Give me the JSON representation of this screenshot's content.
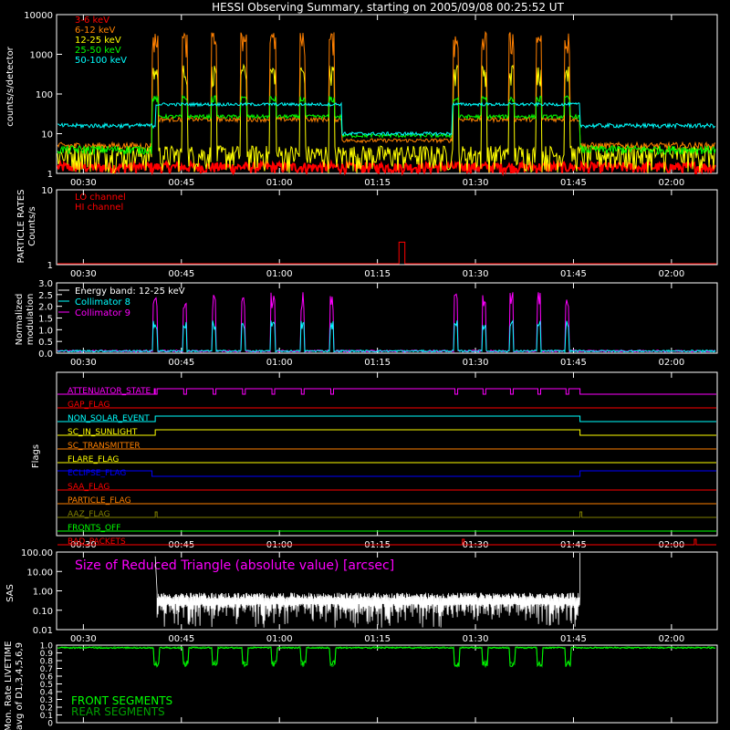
{
  "title": "HESSI Observing Summary, starting on 2005/09/08 00:25:52 UT",
  "time_ticks": [
    "00:30",
    "00:45",
    "01:00",
    "01:15",
    "01:30",
    "01:45",
    "02:00"
  ],
  "colors": {
    "background": "#000000",
    "axes": "#ffffff",
    "band_3_6": "#ff0000",
    "band_6_12": "#ff8000",
    "band_12_25": "#ffff00",
    "band_25_50": "#00ff00",
    "band_50_100": "#00ffff",
    "magenta": "#ff00ff",
    "front": "#00ff00",
    "rear": "#00a000"
  },
  "chart_data": [
    {
      "type": "line",
      "ylabel": "counts/s/detector",
      "y_scale": "log",
      "ylim": [
        1,
        10000
      ],
      "yticks": [
        "1",
        "10",
        "100",
        "1000",
        "10000"
      ],
      "x_unit": "UT (minutes since 00:00)",
      "xlim": [
        25.9,
        127
      ],
      "pulses": [
        41,
        45.5,
        50,
        54.5,
        59,
        63.5,
        68,
        87,
        91.3,
        95.5,
        99.7,
        104
      ],
      "series": [
        {
          "name": "3-6 keV",
          "color": "#ff0000",
          "base": 1.5,
          "peak": 2
        },
        {
          "name": "6-12 keV",
          "color": "#ff8000",
          "base": 5.5,
          "peak": 3000
        },
        {
          "name": "12-25 keV",
          "color": "#ffff00",
          "base": 2.5,
          "peak": 500
        },
        {
          "name": "25-50 keV",
          "color": "#00ff00",
          "base": 25,
          "peak": 70
        },
        {
          "name": "50-100 keV",
          "color": "#00ffff",
          "base": 55,
          "peak": 80
        }
      ]
    },
    {
      "type": "line",
      "ylabel": "PARTICLE RATES",
      "ylabel2": "Counts/s",
      "y_scale": "log",
      "ylim": [
        1,
        10
      ],
      "yticks": [
        "1",
        "10"
      ],
      "series": [
        {
          "name": "LO channel",
          "color": "#ff0000",
          "values": "1 (flat), brief step to 2 at ~01:23"
        },
        {
          "name": "HI channel",
          "color": "#ff0000"
        }
      ]
    },
    {
      "type": "line",
      "ylabel": "Normalized",
      "ylabel2": "modulation",
      "ylim": [
        0,
        3
      ],
      "yticks": [
        "0.0",
        "0.5",
        "1.0",
        "1.5",
        "2.0",
        "2.5",
        "3.0"
      ],
      "legend_title": "Energy band: 12-25 keV",
      "series": [
        {
          "name": "Collimator 8",
          "color": "#00ffff",
          "peak": 1.4
        },
        {
          "name": "Collimator 9",
          "color": "#ff00ff",
          "peak": 2.6
        }
      ]
    },
    {
      "type": "table",
      "ylabel": "Flags",
      "flags": [
        {
          "name": "ATTENUATOR_STATE",
          "color": "#ff00ff",
          "state": "pulses",
          "on_interval": [
            41,
            106
          ]
        },
        {
          "name": "GAP_FLAG",
          "color": "#ff0000",
          "state": "off"
        },
        {
          "name": "NON_SOLAR_EVENT",
          "color": "#00ffff",
          "state": "on",
          "on_interval": [
            41,
            106
          ]
        },
        {
          "name": "SC_IN_SUNLIGHT",
          "color": "#ffff00",
          "state": "on",
          "on_interval": [
            41,
            106
          ]
        },
        {
          "name": "SC_TRANSMITTER",
          "color": "#ff8000",
          "state": "off"
        },
        {
          "name": "FLARE_FLAG",
          "color": "#ffff00",
          "state": "off"
        },
        {
          "name": "ECLIPSE_FLAG",
          "color": "#0000ff",
          "state": "inverse",
          "off_interval": [
            40.5,
            106
          ]
        },
        {
          "name": "SAA_FLAG",
          "color": "#ff0000",
          "state": "off"
        },
        {
          "name": "PARTICLE_FLAG",
          "color": "#ff8000",
          "state": "off"
        },
        {
          "name": "AAZ_FLAG",
          "color": "#808000",
          "state": "blips",
          "blips": [
            41,
            106
          ]
        },
        {
          "name": "FRONTS_OFF",
          "color": "#00ff00",
          "state": "off"
        },
        {
          "name": "BAD_PACKETS",
          "color": "#ff0000",
          "state": "blips",
          "blips": [
            88,
            123.5
          ]
        }
      ]
    },
    {
      "type": "line",
      "ylabel": "SAS",
      "y_scale": "log",
      "ylim": [
        0.01,
        100
      ],
      "yticks": [
        "0.01",
        "0.10",
        "1.00",
        "10.00",
        "100.00"
      ],
      "annotation": "Size of Reduced Triangle (absolute value) [arcsec]",
      "series": [
        {
          "name": "SAS",
          "color": "#ffffff",
          "range": [
            0.02,
            0.8
          ],
          "on_interval": [
            41,
            106
          ]
        }
      ]
    },
    {
      "type": "line",
      "ylabel": "Mon. Rate LIVETIME",
      "ylabel2": "avg of D1,3,4,5,6,9",
      "ylim": [
        0,
        1
      ],
      "yticks": [
        "0",
        "0.1",
        "0.2",
        "0.3",
        "0.4",
        "0.5",
        "0.6",
        "0.7",
        "0.8",
        "0.9",
        "1.0"
      ],
      "series": [
        {
          "name": "FRONT SEGMENTS",
          "color": "#00ff00",
          "base": 0.98,
          "dip_min": 0.72
        },
        {
          "name": "REAR SEGMENTS",
          "color": "#00a000"
        }
      ]
    }
  ]
}
